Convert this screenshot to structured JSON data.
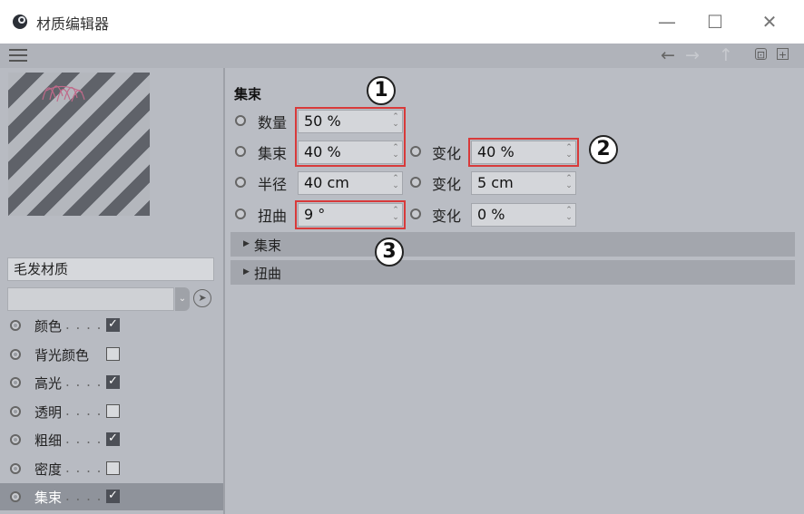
{
  "window": {
    "title": "材质编辑器",
    "controls": {
      "minimize": "—",
      "maximize": "☐",
      "close": "✕"
    }
  },
  "menubar": {
    "icons": [
      "menu-icon",
      "back-arrow-icon",
      "forward-arrow-icon",
      "up-arrow-icon",
      "lock-icon",
      "new-window-icon"
    ]
  },
  "left": {
    "material_name": "毛发材质",
    "channels": [
      {
        "label": "颜色",
        "dots": ". . . .",
        "checked": true,
        "active": false
      },
      {
        "label": "背光颜色",
        "dots": "",
        "checked": false,
        "active": false
      },
      {
        "label": "高光",
        "dots": ". . . .",
        "checked": true,
        "active": false
      },
      {
        "label": "透明",
        "dots": ". . . .",
        "checked": false,
        "active": false
      },
      {
        "label": "粗细",
        "dots": ". . . .",
        "checked": true,
        "active": false
      },
      {
        "label": "密度",
        "dots": ". . . .",
        "checked": false,
        "active": false
      },
      {
        "label": "集束",
        "dots": ". . . .",
        "checked": true,
        "active": true
      }
    ]
  },
  "right": {
    "section_title": "集束",
    "params": {
      "count": {
        "label": "数量",
        "value": "50 %"
      },
      "clump": {
        "label": "集束",
        "value": "40 %"
      },
      "clump_var": {
        "label": "变化",
        "value": "40 %"
      },
      "radius": {
        "label": "半径",
        "value": "40 cm"
      },
      "radius_var": {
        "label": "变化",
        "value": "5 cm"
      },
      "twist": {
        "label": "扭曲",
        "value": "9 °"
      },
      "twist_var": {
        "label": "变化",
        "value": "0 %"
      }
    },
    "groups": [
      "集束",
      "扭曲"
    ]
  },
  "callouts": [
    "1",
    "2",
    "3"
  ],
  "colors": {
    "highlight_box": "#d83a3a",
    "active_channel": "#8f939b",
    "panel": "#babdc4"
  }
}
